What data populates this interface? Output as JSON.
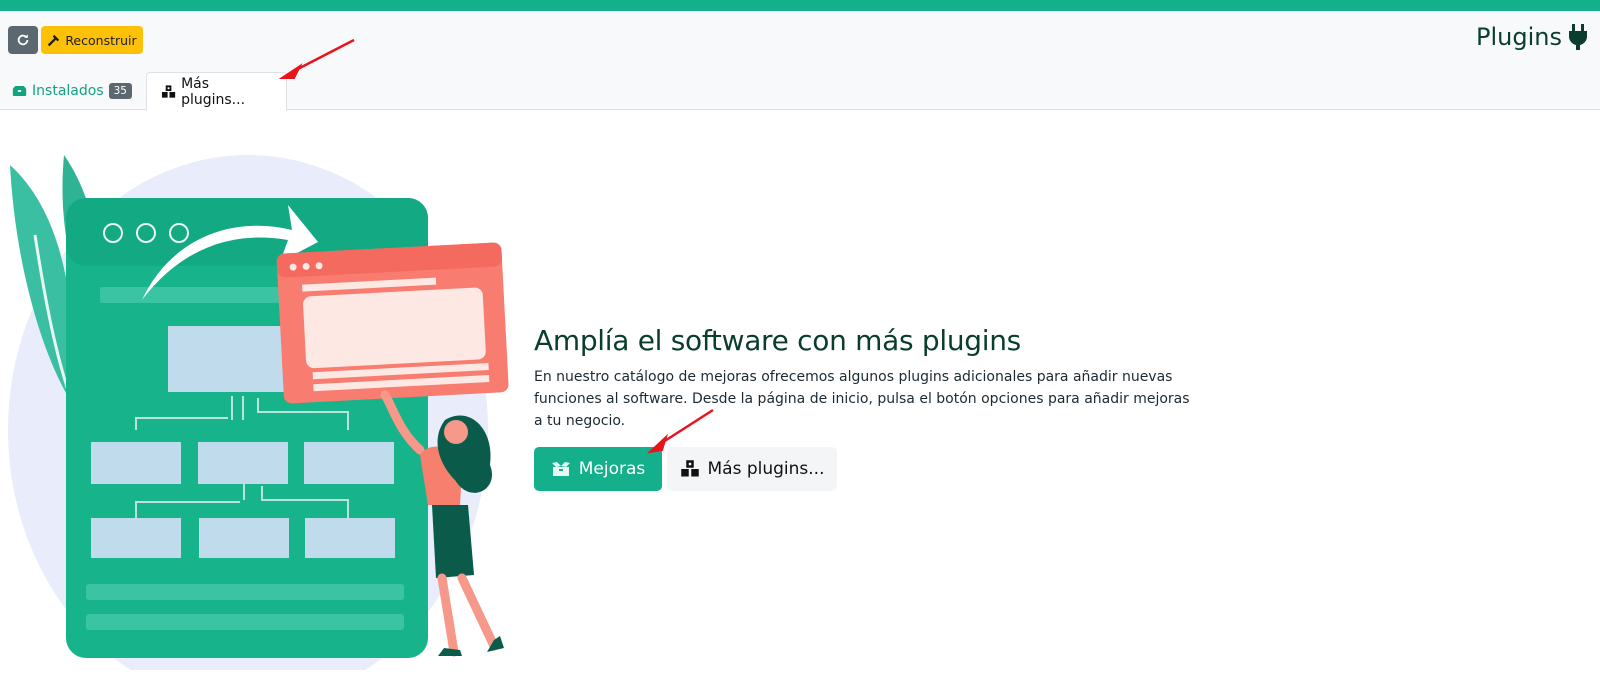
{
  "header": {
    "refresh_icon": "refresh-icon",
    "rebuild_label": "Reconstruir",
    "rebuild_icon": "hammer-icon",
    "title": "Plugins",
    "title_icon": "plug-icon"
  },
  "tabs": [
    {
      "label": "Instalados",
      "badge": "35",
      "icon": "boxes-icon"
    },
    {
      "label": "Más plugins...",
      "icon": "cubes-icon"
    }
  ],
  "main": {
    "heading": "Amplía el software con más plugins",
    "description": "En nuestro catálogo de mejoras ofrecemos algunos plugins adicionales para añadir nuevas funciones al software. Desde la página de inicio, pulsa el botón opciones para añadir mejoras a tu negocio.",
    "mejoras_label": "Mejoras",
    "more_plugins_label": "Más plugins..."
  },
  "colors": {
    "accent": "#14b08b",
    "warning": "#ffc107",
    "secondary": "#5c6870",
    "annotation": "#e8141c"
  }
}
